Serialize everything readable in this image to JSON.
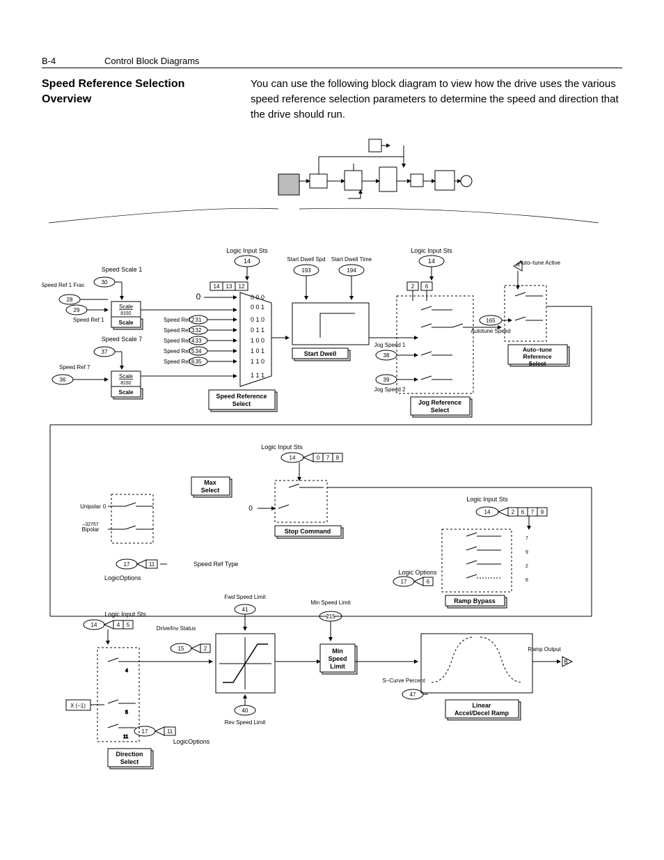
{
  "header": {
    "page_num": "B-4",
    "chapter_title": "Control Block Diagrams"
  },
  "section": {
    "title": "Speed Reference Selection Overview",
    "intro": "You can use the following block diagram to view how the drive uses the various speed reference selection parameters to determine the speed and direction that the drive should run."
  },
  "diagram": {
    "top_section": {
      "logic_input_sts_left": {
        "label": "Logic Input Sts",
        "param": "14",
        "bits": [
          "14",
          "13",
          "12"
        ]
      },
      "logic_input_sts_right": {
        "label": "Logic Input Sts",
        "param": "14",
        "bits": [
          "2",
          "6"
        ]
      },
      "start_dwell_spd": {
        "label": "Start Dwell Spd",
        "param": "193"
      },
      "start_dwell_time": {
        "label": "Start Dwell Time",
        "param": "194"
      },
      "autotune_active": {
        "label": "Auto–tune Active",
        "pin": "A"
      },
      "speed_scale_1": {
        "label": "Speed Scale 1",
        "param": "30"
      },
      "speed_ref_1_frac": {
        "label": "Speed Ref 1 Frac",
        "params": [
          "28",
          "29"
        ]
      },
      "speed_ref_1": {
        "label": "Speed Ref 1"
      },
      "speed_scale_7": {
        "label": "Speed Scale 7",
        "param": "37"
      },
      "speed_ref_7": {
        "label": "Speed Ref 7",
        "param": "36"
      },
      "scale_box_1": {
        "label": "Scale",
        "value": "8192",
        "sub": "Scale"
      },
      "scale_box_7": {
        "label": "Scale",
        "value": "8192",
        "sub": "Scale"
      },
      "speed_refs": [
        {
          "label": "Speed Ref 2",
          "param": "31",
          "code": "0  1  0"
        },
        {
          "label": "Speed Ref 3",
          "param": "32",
          "code": "0  1  1"
        },
        {
          "label": "Speed Ref 4",
          "param": "33",
          "code": "1  0  0"
        },
        {
          "label": "Speed Ref 5",
          "param": "34",
          "code": "1  0  1"
        },
        {
          "label": "Speed Ref 6",
          "param": "35",
          "code": "1  1  0"
        }
      ],
      "zero_input": "0",
      "mux_codes_extra": [
        "0  0  0",
        "0  0  1",
        "1  1  1"
      ],
      "autotune_speed": {
        "label": "Autotune Speed",
        "param": "165"
      },
      "jog_speed_1": {
        "label": "Jog Speed 1",
        "param": "38"
      },
      "jog_speed_2": {
        "label": "Jog Speed 2",
        "param": "39"
      },
      "block_speed_ref_select": "Speed Reference Select",
      "block_start_dwell": "Start Dwell",
      "block_jog_ref_select": "Jog Reference Select",
      "block_autotune_ref_select": "Auto–tune Reference Select"
    },
    "bottom_section": {
      "logic_input_sts_mid": {
        "label": "Logic Input Sts",
        "param": "14",
        "bits": [
          "0",
          "7",
          "8"
        ]
      },
      "max_select": "Max Select",
      "unipolar": {
        "label": "Unipolar",
        "value": "0"
      },
      "bipolar": {
        "label": "Bipolar",
        "value": "–32767"
      },
      "speed_ref_type": {
        "label": "Speed Ref Type",
        "param": "17",
        "bit": "11"
      },
      "logic_options_left": {
        "label": "LogicOptions"
      },
      "stop_command_zero": "0",
      "block_stop_command": "Stop Command",
      "logic_input_sts_right": {
        "label": "Logic Input Sts",
        "param": "14",
        "bits": [
          "2",
          "6",
          "7",
          "9"
        ]
      },
      "logic_options_right": {
        "label": "Logic Options",
        "param": "17",
        "bit": "6"
      },
      "switch_labels": [
        "7",
        "9",
        "2",
        "6"
      ],
      "block_ramp_bypass": "Ramp Bypass",
      "logic_input_sts_dir": {
        "label": "Logic Input Sts",
        "param": "14",
        "bits": [
          "4",
          "5"
        ]
      },
      "drive_inv_status": {
        "label": "Drive/Inv Status",
        "param": "15",
        "bit": "2"
      },
      "x_neg1": "X (–1)",
      "dir_switch_labels": [
        "4",
        "5",
        "11"
      ],
      "logic_options_dir": {
        "label": "LogicOptions",
        "param": "17",
        "bit": "11"
      },
      "block_direction_select": "Direction Select",
      "fwd_speed_limit": {
        "label": "Fwd Speed Limit",
        "param": "41"
      },
      "rev_speed_limit": {
        "label": "Rev Speed Limit",
        "param": "40"
      },
      "min_speed_limit_param": {
        "label": "Min Speed Limit",
        "param": "215"
      },
      "block_min_speed_limit": "Min Speed Limit",
      "s_curve_percent": {
        "label": "S–Curve Percent",
        "param": "47"
      },
      "block_linear_ramp": "Linear Accel/Decel Ramp",
      "ramp_output": {
        "label": "Ramp Output",
        "pin": "B"
      }
    }
  }
}
